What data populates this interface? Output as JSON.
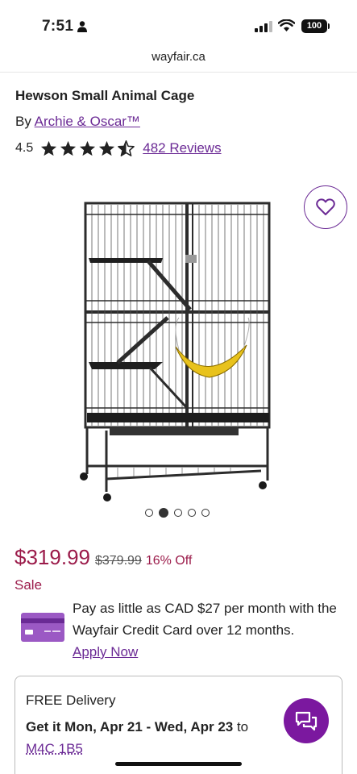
{
  "status_bar": {
    "time": "7:51",
    "battery": "100"
  },
  "browser": {
    "url": "wayfair.ca"
  },
  "product": {
    "title": "Hewson Small Animal Cage",
    "by_prefix": "By ",
    "brand": "Archie & Oscar™",
    "rating": "4.5",
    "rating_stars": 4.5,
    "reviews": "482 Reviews"
  },
  "carousel": {
    "total": 5,
    "active": 2
  },
  "pricing": {
    "current": "$319.99",
    "was": "$379.99",
    "discount": "16% Off",
    "badge": "Sale"
  },
  "credit": {
    "text": "Pay as little as CAD $27 per month with the Wayfair Credit Card over 12 months.",
    "link": "Apply Now"
  },
  "delivery": {
    "title": "FREE Delivery",
    "dates_bold": "Get it Mon, Apr 21 - Wed, Apr 23",
    "dates_suffix": " to",
    "postal_code": "M4C 1B5"
  },
  "colors": {
    "brand_purple": "#7b189f",
    "link_purple": "#6b2a95",
    "sale_red": "#9b1b4a"
  },
  "icons": {
    "person": "person-icon",
    "signal": "signal-icon",
    "wifi": "wifi-icon",
    "heart": "heart-icon",
    "star": "star-icon",
    "card": "credit-card-icon",
    "chat": "chat-icon"
  }
}
